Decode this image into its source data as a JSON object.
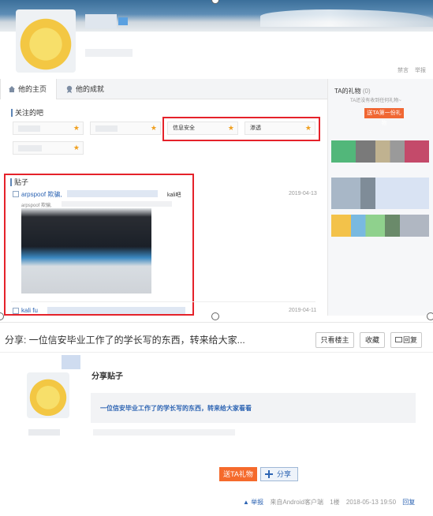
{
  "header": {
    "links": [
      "禁言",
      "举报"
    ]
  },
  "tabs": [
    {
      "label": "他的主页",
      "icon": "home-icon",
      "active": true
    },
    {
      "label": "他的成就",
      "icon": "achievement-icon",
      "active": false
    }
  ],
  "followed_bars": {
    "title": "关注的吧",
    "items": [
      {
        "name": ""
      },
      {
        "name": ""
      },
      {
        "name": "信息安全"
      },
      {
        "name": "渗透"
      },
      {
        "name": ""
      }
    ]
  },
  "posts": {
    "title": "贴子",
    "items": [
      {
        "title": "arpspoof 欺骗,",
        "snippet": "arpspoof 欺骗,",
        "bar": "kali吧",
        "date": "2019-04-13"
      },
      {
        "title": "kali fu",
        "date": "2019-04-11"
      }
    ]
  },
  "gifts": {
    "title": "TA的礼物",
    "count": "(0)",
    "empty_text": "TA还没有收到任何礼物~",
    "button": "送TA第一份礼物"
  },
  "thread": {
    "title": "分享: 一位信安毕业工作了的学长写的东西，转来给大家...",
    "buttons": [
      "只看楼主",
      "收藏",
      "回复"
    ],
    "post_heading": "分享贴子",
    "share_text": "一位信安毕业工作了的学长写的东西，转来给大家看看",
    "gift_button": "送TA礼物",
    "share_button": "分享",
    "footer": {
      "report": "举报",
      "client": "来自Android客户端",
      "floor": "1楼",
      "time": "2018-05-13 19:50",
      "reply": "回复"
    }
  },
  "colors": {
    "accent_red": "#e5222a",
    "link_blue": "#2d64b3",
    "orange": "#f56a2c"
  }
}
